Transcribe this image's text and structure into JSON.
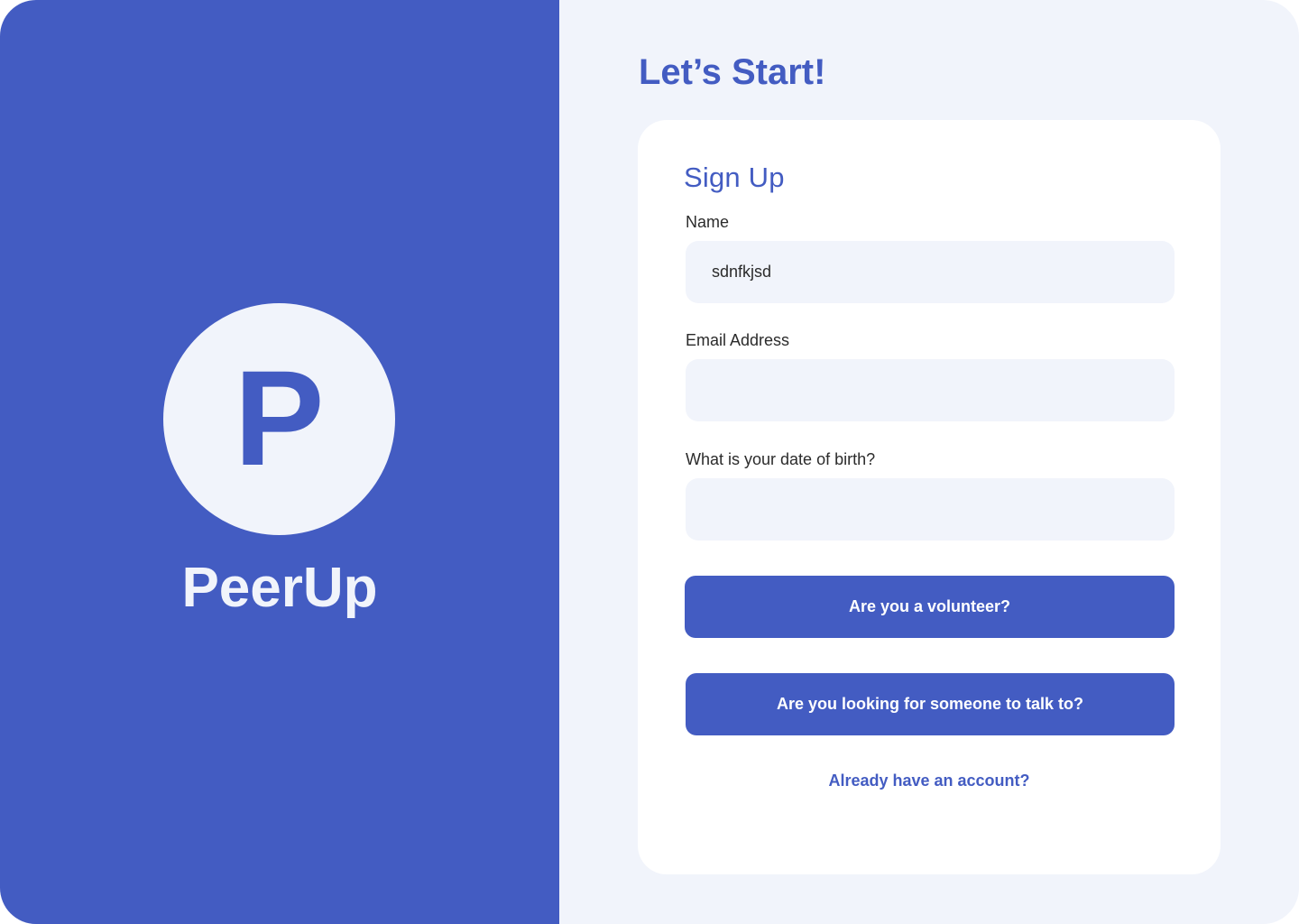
{
  "brand": {
    "logo_letter": "P",
    "name": "PeerUp"
  },
  "page": {
    "title": "Let’s Start!"
  },
  "form": {
    "title": "Sign Up",
    "fields": [
      {
        "label": "Name",
        "value": "sdnfkjsd",
        "placeholder": ""
      },
      {
        "label": "Email Address",
        "value": "",
        "placeholder": ""
      },
      {
        "label": "What is your date of birth?",
        "value": "",
        "placeholder": ""
      }
    ],
    "buttons": {
      "volunteer": "Are you a volunteer?",
      "seeker": "Are you looking for someone to talk to?"
    },
    "login_link": "Already have an account?"
  },
  "colors": {
    "primary": "#435cc2",
    "background_light": "#f1f4fb",
    "card": "#ffffff",
    "text_dark": "#2b2b2b"
  }
}
